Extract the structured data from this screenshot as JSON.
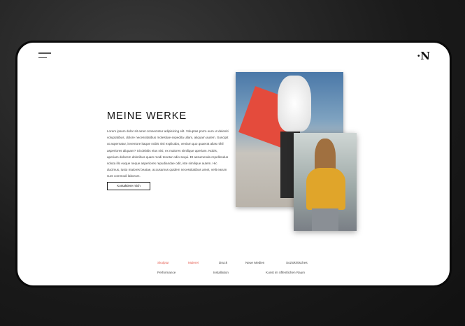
{
  "header": {
    "logo": "·N",
    "menu_icon": "hamburger-icon"
  },
  "hero": {
    "title": "MEINE WERKE",
    "text": "Lorem ipsum dolor sit amet consectetur adipisicing elit. Voluptas porro eum ut deleniti voluptatibus, dolore necessitatibus molestiae expedita ullam, aliquam autem. Suscipit ut aspernatur, inventore itaque nobis nisi explicabo, veniam quo quaerat alias nihil asperiores aliquam? Sit debitis eius nisi, ex maiores similique aperiam. Nobis, aperiam dolorem doloribus quam modi tenetur odio sequi. Et assumenda repellendus soluta illo eaque neque asperiores repudiandae odit, iste similique autem. Hic ducimus, iusto maiores beatae, accusamus quidem necessitatibus amet, velit earum sunt commodi laborum.",
    "button": "Kontaktiere mich"
  },
  "categories": [
    "Skulptur",
    "Malerei",
    "Druck",
    "Neue Medien",
    "Soziokritisches",
    "Performance",
    "Installation",
    "Kunst im öffentlichen Raum"
  ],
  "colors": {
    "accent": "#e55a4e"
  }
}
